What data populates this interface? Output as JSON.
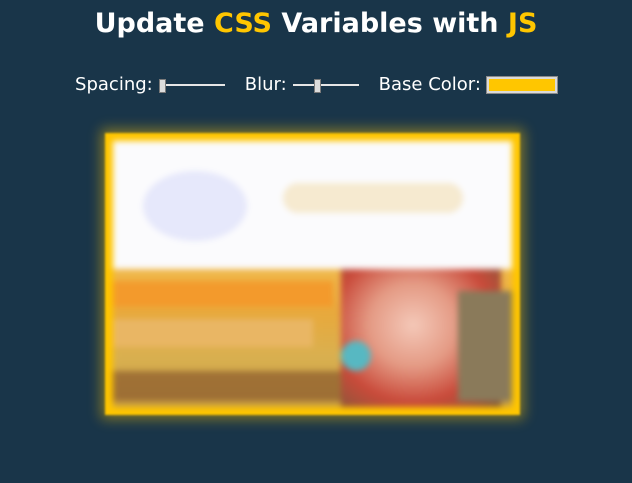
{
  "heading": {
    "part1": "Update ",
    "part2": "CSS",
    "part3": " Variables with ",
    "part4": "JS"
  },
  "controls": {
    "spacing_label": "Spacing:",
    "blur_label": "Blur:",
    "base_color_label": "Base Color:",
    "spacing_value": 0.0,
    "blur_value": 0.35,
    "base_color": "#ffc600"
  },
  "colors": {
    "background": "#193549",
    "accent": "#ffc600"
  },
  "image": {
    "description_name": "blurred-photo"
  }
}
